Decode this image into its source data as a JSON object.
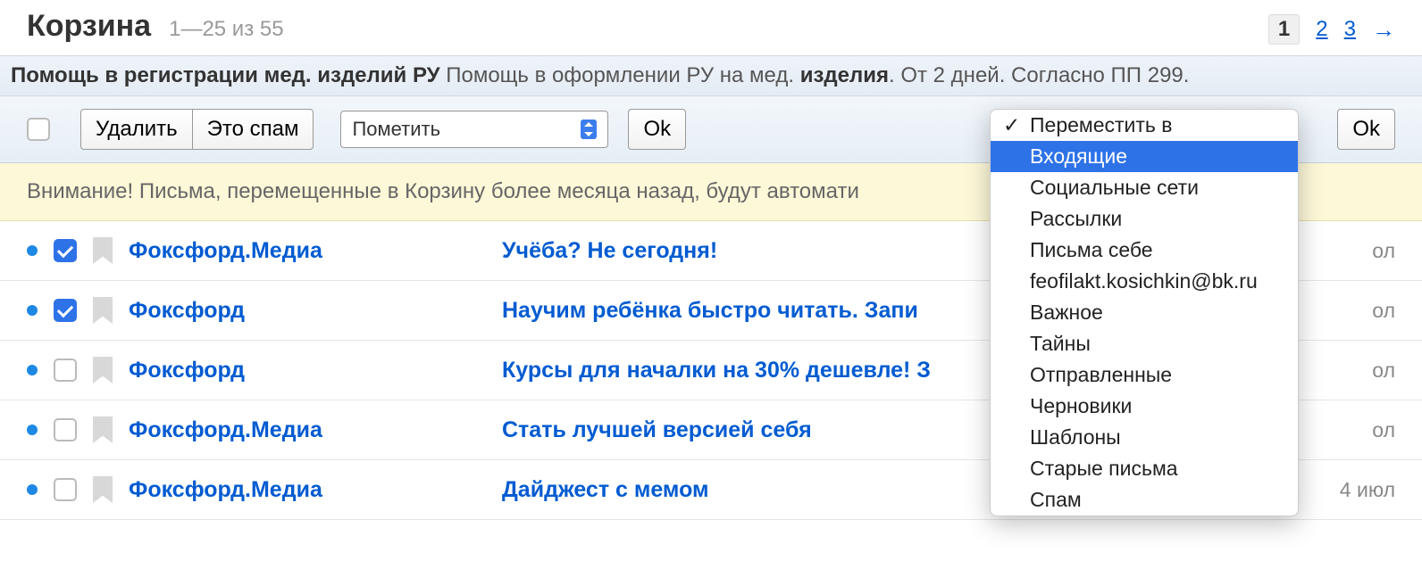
{
  "header": {
    "title": "Корзина",
    "range": "1—25 из 55",
    "pages": {
      "current": "1",
      "p2": "2",
      "p3": "3"
    }
  },
  "ad": {
    "bold1": "Помощь в регистрации мед. изделий РУ",
    "text1": " Помощь в оформлении РУ на мед. ",
    "bold2": "изделия",
    "text2": ". От 2 дней. Согласно ПП 299."
  },
  "toolbar": {
    "delete": "Удалить",
    "spam": "Это спам",
    "mark_select": "Пометить",
    "ok": "Ok",
    "move_select": "Переместить в",
    "ok2": "Ok"
  },
  "dropdown": {
    "header": "Переместить в",
    "items": [
      "Входящие",
      "Социальные сети",
      "Рассылки",
      "Письма себе",
      "feofilakt.kosichkin@bk.ru",
      "Важное",
      "Тайны",
      "Отправленные",
      "Черновики",
      "Шаблоны",
      "Старые письма",
      "Спам"
    ]
  },
  "notice": "Внимание! Письма, перемещенные в Корзину более месяца назад, будут автомати",
  "mails": [
    {
      "checked": true,
      "sender": "Фоксфорд.Медиа",
      "subject": "Учёба? Не сегодня!",
      "date": "ол"
    },
    {
      "checked": true,
      "sender": "Фоксфорд",
      "subject": "Научим ребёнка быстро читать. Запи",
      "date": "ол"
    },
    {
      "checked": false,
      "sender": "Фоксфорд",
      "subject": "Курсы для началки на 30% дешевле! З",
      "date": "ол"
    },
    {
      "checked": false,
      "sender": "Фоксфорд.Медиа",
      "subject": "Стать лучшей версией себя",
      "date": "ол"
    },
    {
      "checked": false,
      "sender": "Фоксфорд.Медиа",
      "subject": "Дайджест с мемом",
      "date": "4 июл"
    }
  ]
}
